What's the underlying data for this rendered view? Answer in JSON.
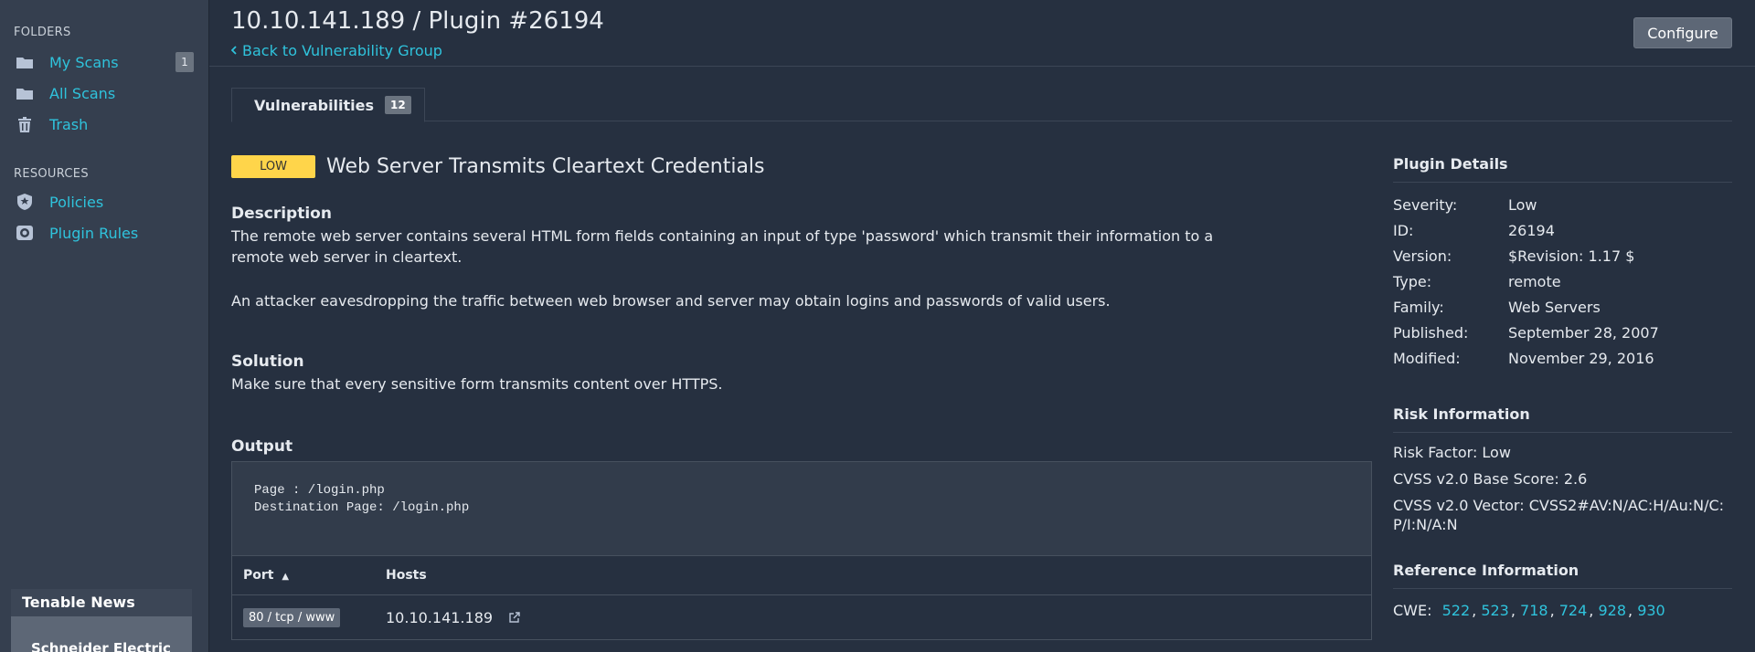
{
  "sidebar": {
    "folders_heading": "FOLDERS",
    "folders": [
      {
        "label": "My Scans",
        "icon": "folder-icon",
        "count": "1"
      },
      {
        "label": "All Scans",
        "icon": "folder-icon"
      },
      {
        "label": "Trash",
        "icon": "trash-icon"
      }
    ],
    "resources_heading": "RESOURCES",
    "resources": [
      {
        "label": "Policies",
        "icon": "policy-shield-icon"
      },
      {
        "label": "Plugin Rules",
        "icon": "plugin-rules-icon"
      }
    ],
    "news": {
      "title": "Tenable News",
      "headline": "Schneider Electric"
    }
  },
  "header": {
    "title": "10.10.141.189 / Plugin #26194",
    "back_label": "Back to Vulnerability Group",
    "configure_label": "Configure"
  },
  "tabs": [
    {
      "label": "Vulnerabilities",
      "count": "12"
    }
  ],
  "vulnerability": {
    "severity": "LOW",
    "severity_color": "#ffd54a",
    "title": "Web Server Transmits Cleartext Credentials",
    "description_heading": "Description",
    "description_p1": "The remote web server contains several HTML form fields containing an input of type 'password' which transmit their information to a remote web server in cleartext.",
    "description_p2": "An attacker eavesdropping the traffic between web browser and server may obtain logins and passwords of valid users.",
    "solution_heading": "Solution",
    "solution": "Make sure that every sensitive form transmits content over HTTPS.",
    "output_heading": "Output",
    "output_text": "Page : /login.php\nDestination Page: /login.php",
    "table": {
      "port_header": "Port",
      "sort_indicator": "▲",
      "hosts_header": "Hosts",
      "rows": [
        {
          "port": "80 / tcp / www",
          "host": "10.10.141.189"
        }
      ]
    }
  },
  "plugin_details": {
    "heading": "Plugin Details",
    "rows": [
      {
        "k": "Severity:",
        "v": "Low"
      },
      {
        "k": "ID:",
        "v": "26194"
      },
      {
        "k": "Version:",
        "v": "$Revision: 1.17 $"
      },
      {
        "k": "Type:",
        "v": "remote"
      },
      {
        "k": "Family:",
        "v": "Web Servers"
      },
      {
        "k": "Published:",
        "v": "September 28, 2007"
      },
      {
        "k": "Modified:",
        "v": "November 29, 2016"
      }
    ]
  },
  "risk_information": {
    "heading": "Risk Information",
    "risk_factor": "Risk Factor: Low",
    "cvss_base": "CVSS v2.0 Base Score: 2.6",
    "cvss_vector": "CVSS v2.0 Vector: CVSS2#AV:N/AC:H/Au:N/C:P/I:N/A:N"
  },
  "reference_information": {
    "heading": "Reference Information",
    "cwe_label": "CWE:",
    "cwe_links": [
      "522",
      "523",
      "718",
      "724",
      "928",
      "930"
    ]
  },
  "colors": {
    "background": "#263040",
    "sidebar": "#353f4f",
    "link": "#2fc3dc",
    "severity_low": "#ffd54a"
  }
}
